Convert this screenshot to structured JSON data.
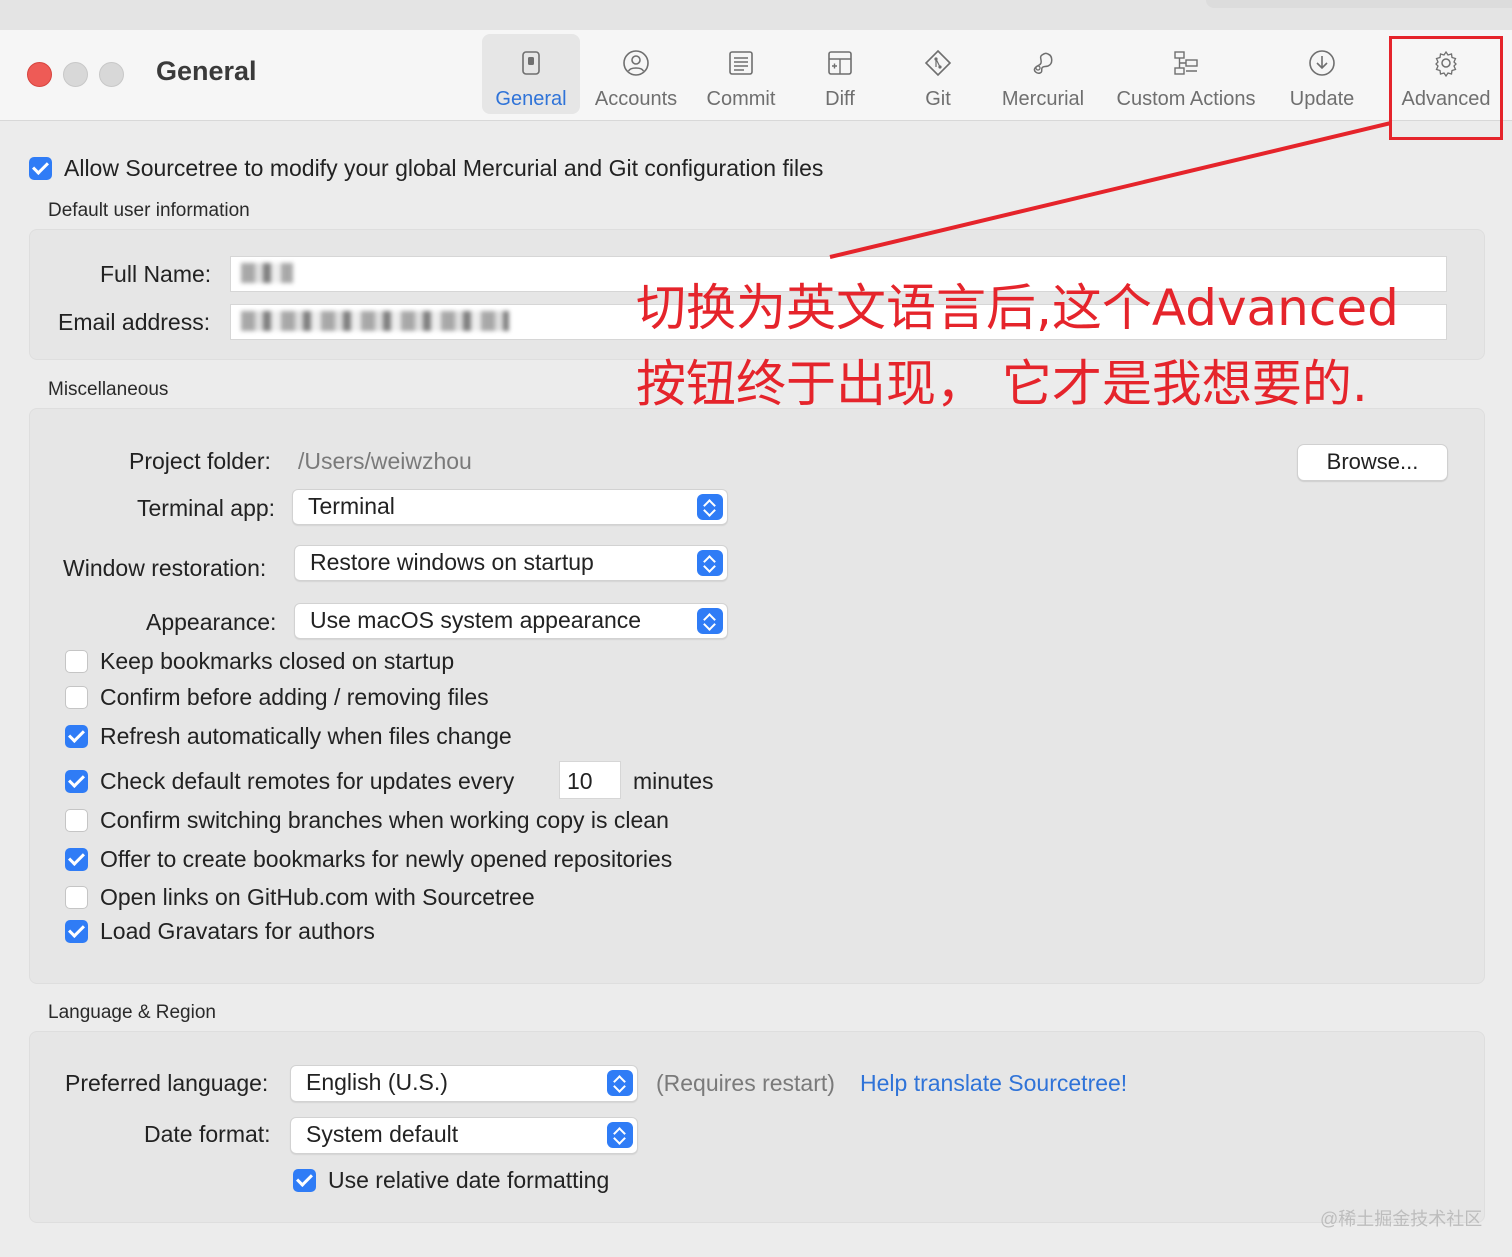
{
  "window": {
    "title": "General"
  },
  "toolbar": {
    "tabs": [
      {
        "label": "General",
        "icon": "toggle-icon",
        "active": true
      },
      {
        "label": "Accounts",
        "icon": "user-circle-icon",
        "active": false
      },
      {
        "label": "Commit",
        "icon": "document-icon",
        "active": false
      },
      {
        "label": "Diff",
        "icon": "diff-icon",
        "active": false
      },
      {
        "label": "Git",
        "icon": "git-icon",
        "active": false
      },
      {
        "label": "Mercurial",
        "icon": "mercurial-icon",
        "active": false
      },
      {
        "label": "Custom Actions",
        "icon": "custom-actions-icon",
        "active": false
      },
      {
        "label": "Update",
        "icon": "download-icon",
        "active": false
      },
      {
        "label": "Advanced",
        "icon": "gear-icon",
        "active": false
      }
    ]
  },
  "annotation": {
    "line1": "切换为英文语言后,这个Advanced",
    "line2": "按钮终于出现， 它才是我想要的.",
    "color": "#e5242b"
  },
  "global_config": {
    "label": "Allow Sourcetree to modify your global Mercurial and Git configuration files",
    "checked": true
  },
  "user_info": {
    "heading": "Default user information",
    "full_name_label": "Full Name:",
    "email_label": "Email address:"
  },
  "misc": {
    "heading": "Miscellaneous",
    "project_folder_label": "Project folder:",
    "project_folder_value": "/Users/weiwzhou",
    "browse_label": "Browse...",
    "terminal_label": "Terminal app:",
    "terminal_value": "Terminal",
    "window_restoration_label": "Window restoration:",
    "window_restoration_value": "Restore windows on startup",
    "appearance_label": "Appearance:",
    "appearance_value": "Use macOS system appearance",
    "options": [
      {
        "label": "Keep bookmarks closed on startup",
        "checked": false
      },
      {
        "label": "Confirm before adding / removing files",
        "checked": false
      },
      {
        "label": "Refresh automatically when files change",
        "checked": true
      },
      {
        "label": "Check default remotes for updates every",
        "checked": true
      },
      {
        "label": "Confirm switching branches when working copy is clean",
        "checked": false
      },
      {
        "label": "Offer to create bookmarks for newly opened repositories",
        "checked": true
      },
      {
        "label": "Open links on GitHub.com with Sourcetree",
        "checked": false
      },
      {
        "label": "Load Gravatars for authors",
        "checked": true
      }
    ],
    "update_interval_value": "10",
    "update_interval_unit": "minutes"
  },
  "language": {
    "heading": "Language & Region",
    "preferred_label": "Preferred language:",
    "preferred_value": "English (U.S.)",
    "requires_restart": "(Requires restart)",
    "help_link": "Help translate Sourcetree!",
    "date_format_label": "Date format:",
    "date_format_value": "System default",
    "relative_date_label": "Use relative date formatting",
    "relative_date_checked": true
  },
  "watermark": "@稀土掘金技术社区",
  "colors": {
    "accent": "#2f7cf6",
    "link": "#2f73d8"
  }
}
